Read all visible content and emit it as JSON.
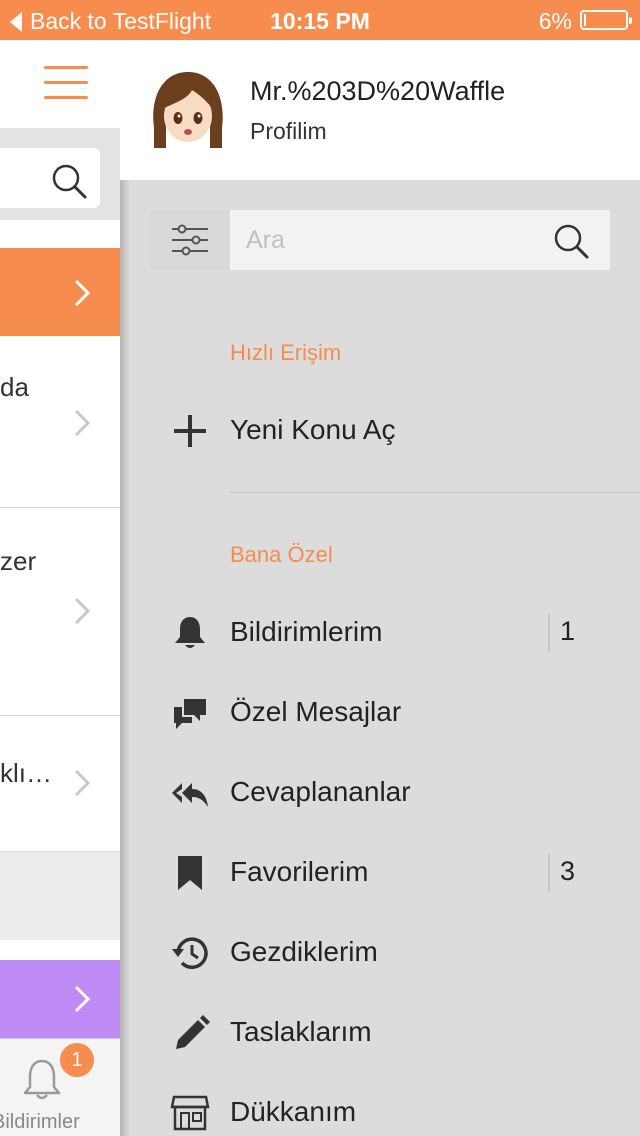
{
  "status_bar": {
    "back_label": "Back to TestFlight",
    "time": "10:15 PM",
    "battery": "6%",
    "battery_level": 0.06
  },
  "left_screen": {
    "items": [
      {
        "text": "da"
      },
      {
        "text": "zer"
      },
      {
        "text": "klı…"
      }
    ],
    "tab": {
      "label": "Bildirimler",
      "badge": "1"
    }
  },
  "profile": {
    "name": "Mr.%203D%20Waffle",
    "subtitle": "Profilim"
  },
  "search": {
    "placeholder": "Ara",
    "value": ""
  },
  "sections": {
    "quick_access": {
      "title": "Hızlı Erişim",
      "items": [
        {
          "label": "Yeni Konu Aç",
          "icon": "plus-icon"
        }
      ]
    },
    "personal": {
      "title": "Bana Özel",
      "items": [
        {
          "label": "Bildirimlerim",
          "icon": "bell-icon",
          "count": "1"
        },
        {
          "label": "Özel Mesajlar",
          "icon": "messages-icon"
        },
        {
          "label": "Cevaplananlar",
          "icon": "reply-all-icon"
        },
        {
          "label": "Favorilerim",
          "icon": "bookmark-icon",
          "count": "3"
        },
        {
          "label": "Gezdiklerim",
          "icon": "history-icon"
        },
        {
          "label": "Taslaklarım",
          "icon": "pencil-icon"
        },
        {
          "label": "Dükkanım",
          "icon": "shop-icon"
        }
      ]
    }
  },
  "colors": {
    "accent": "#f68c4d",
    "purple": "#bf8bf5",
    "panel_bg": "#dcdcdc"
  }
}
